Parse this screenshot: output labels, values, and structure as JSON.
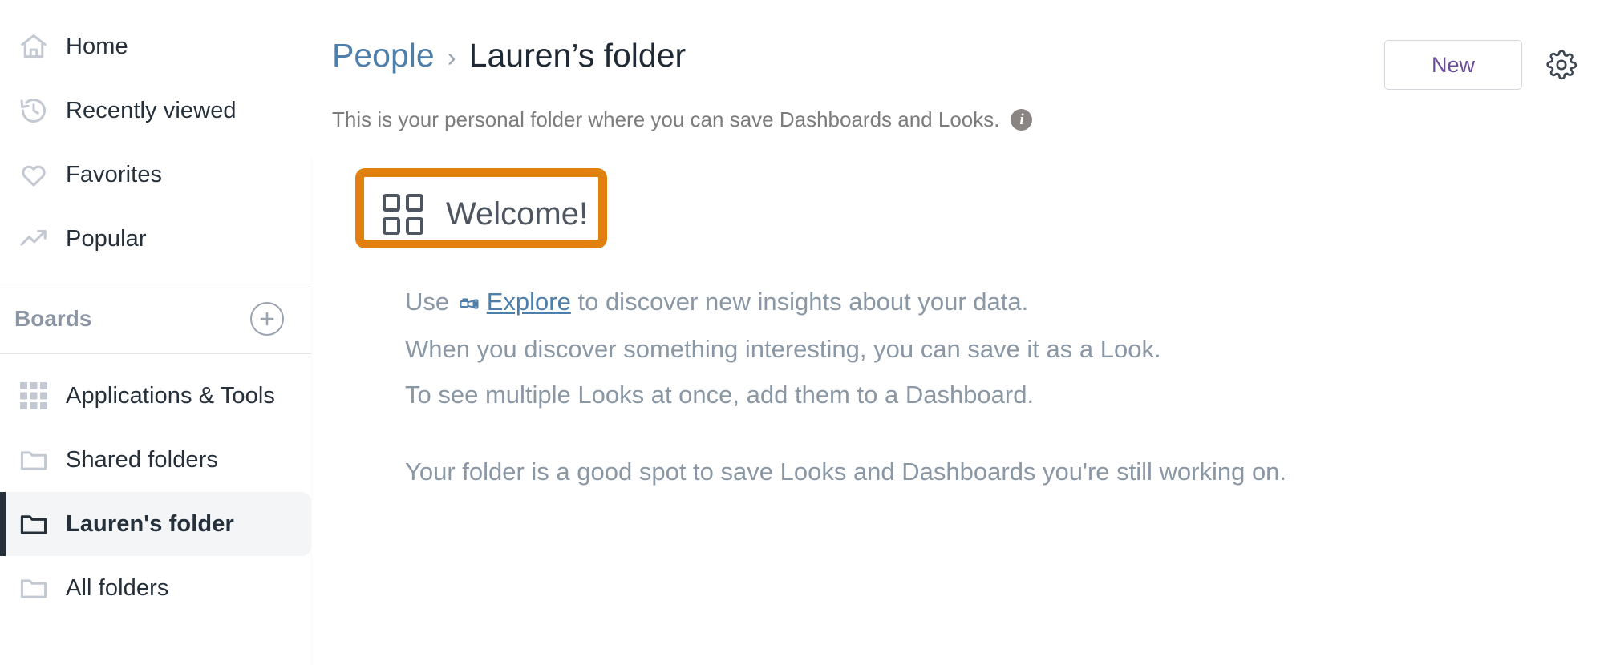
{
  "sidebar": {
    "primary_items": [
      {
        "label": "Home",
        "icon": "home-icon"
      },
      {
        "label": "Recently viewed",
        "icon": "history-icon"
      },
      {
        "label": "Favorites",
        "icon": "heart-icon"
      },
      {
        "label": "Popular",
        "icon": "trending-up-icon"
      }
    ],
    "section": {
      "title": "Boards",
      "add_icon": "plus-circle-icon"
    },
    "folder_items": [
      {
        "label": "Applications & Tools",
        "icon": "grid-apps-icon",
        "selected": false
      },
      {
        "label": "Shared folders",
        "icon": "folder-icon",
        "selected": false
      },
      {
        "label": "Lauren's folder",
        "icon": "folder-icon",
        "selected": true
      },
      {
        "label": "All folders",
        "icon": "folder-icon",
        "selected": false
      }
    ]
  },
  "header": {
    "breadcrumb_parent": "People",
    "breadcrumb_separator": "›",
    "breadcrumb_current": "Lauren’s folder",
    "subtitle": "This is your personal folder where you can save Dashboards and Looks.",
    "info_icon_glyph": "i",
    "new_button_label": "New",
    "settings_icon": "gear-icon"
  },
  "content": {
    "welcome_title": "Welcome!",
    "welcome_icon": "dashboard-grid-icon",
    "annotation_color": "#e2800f",
    "lines": {
      "line1_prefix": "Use ",
      "explore_link": "Explore",
      "explore_icon": "explore-telescope-icon",
      "line1_suffix": " to discover new insights about your data.",
      "line2": "When you discover something interesting, you can save it as a Look.",
      "line3": "To see multiple Looks at once, add them to a Dashboard.",
      "line4": "Your folder is a good spot to save Looks and Dashboards you're still working on."
    }
  },
  "colors": {
    "link_blue": "#4e7eaa",
    "accent_purple": "#6b4e99",
    "annotation_orange": "#e2800f",
    "text_dark": "#25303b",
    "text_muted": "#8a97a5"
  }
}
